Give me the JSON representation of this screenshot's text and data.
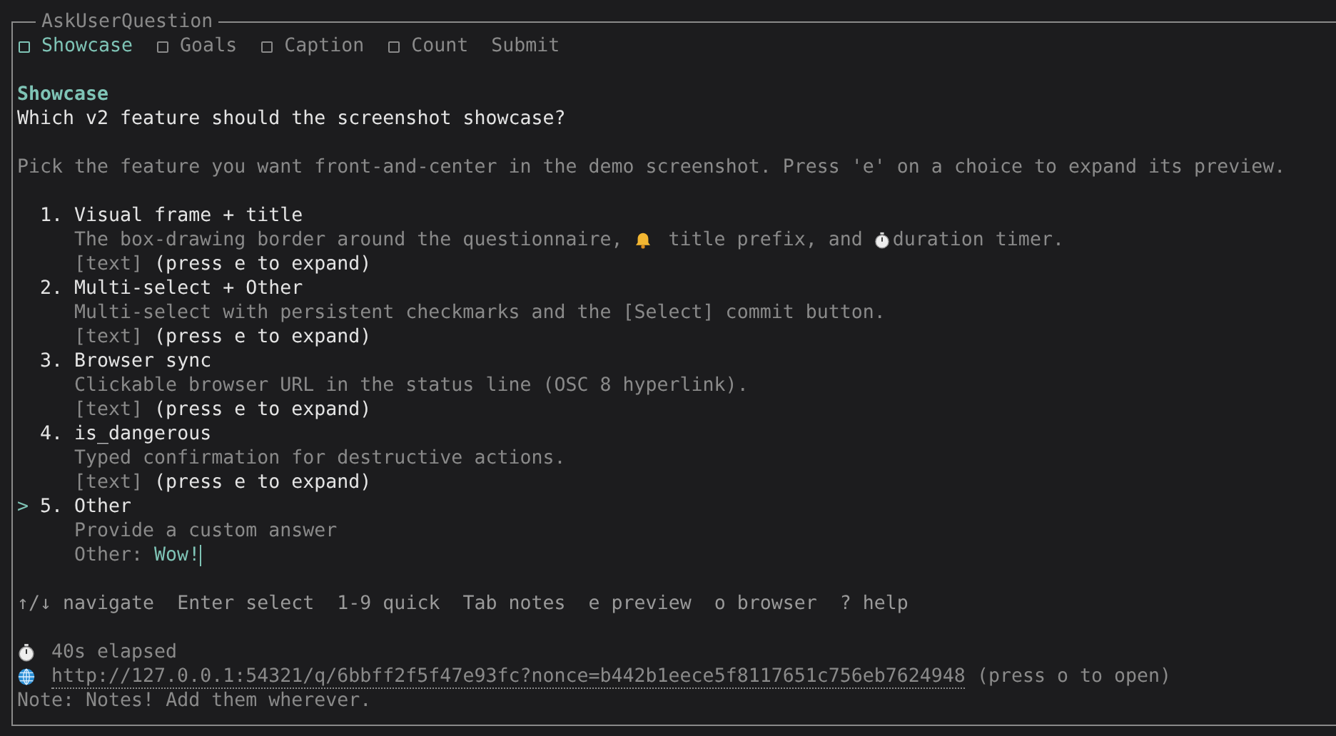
{
  "frame": {
    "title": "AskUserQuestion"
  },
  "tabs": [
    {
      "label": "Showcase",
      "kind": "question",
      "selected": true
    },
    {
      "label": "Goals",
      "kind": "question",
      "selected": false
    },
    {
      "label": "Caption",
      "kind": "question",
      "selected": false
    },
    {
      "label": "Count",
      "kind": "question",
      "selected": false
    },
    {
      "label": "Submit",
      "kind": "submit",
      "selected": false
    }
  ],
  "question": {
    "header": "Showcase",
    "text": "Which v2 feature should the screenshot showcase?",
    "hint": "Pick the feature you want front-and-center in the demo screenshot. Press 'e' on a choice to expand its preview."
  },
  "cursor": ">",
  "options": [
    {
      "kind": "choice",
      "number": "1.",
      "label": "Visual frame + title",
      "selected": false,
      "description": [
        {
          "kind": "text",
          "text": "The box-drawing border around the questionnaire, "
        },
        {
          "kind": "bell"
        },
        {
          "kind": "text",
          "text": " title prefix, and "
        },
        {
          "kind": "stopwatch"
        },
        {
          "kind": "text",
          "text": "duration timer."
        }
      ],
      "preview_tag": "[text]",
      "preview_hint": "(press e to expand)"
    },
    {
      "kind": "choice",
      "number": "2.",
      "label": "Multi-select + Other",
      "selected": false,
      "description": [
        {
          "kind": "text",
          "text": "Multi-select with persistent checkmarks and the [Select] commit button."
        }
      ],
      "preview_tag": "[text]",
      "preview_hint": "(press e to expand)"
    },
    {
      "kind": "choice",
      "number": "3.",
      "label": "Browser sync",
      "selected": false,
      "description": [
        {
          "kind": "text",
          "text": "Clickable browser URL in the status line (OSC 8 hyperlink)."
        }
      ],
      "preview_tag": "[text]",
      "preview_hint": "(press e to expand)"
    },
    {
      "kind": "choice",
      "number": "4.",
      "label": "is_dangerous",
      "selected": false,
      "description": [
        {
          "kind": "text",
          "text": "Typed confirmation for destructive actions."
        }
      ],
      "preview_tag": "[text]",
      "preview_hint": "(press e to expand)"
    },
    {
      "kind": "other",
      "number": "5.",
      "label": "Other",
      "selected": true,
      "description": [
        {
          "kind": "text",
          "text": "Provide a custom answer"
        }
      ],
      "input_label": "Other:",
      "value": "Wow!"
    }
  ],
  "help": [
    "↑/↓ navigate",
    "Enter select",
    "1-9 quick",
    "Tab notes",
    "e preview",
    "o browser",
    "? help"
  ],
  "status": {
    "elapsed": "40s elapsed",
    "url": "http://127.0.0.1:54321/q/6bbff2f5f47e93fc?nonce=b442b1eece5f8117651c756eb7624948",
    "url_hint": "(press o to open)",
    "note": "Note: Notes! Add them wherever."
  }
}
